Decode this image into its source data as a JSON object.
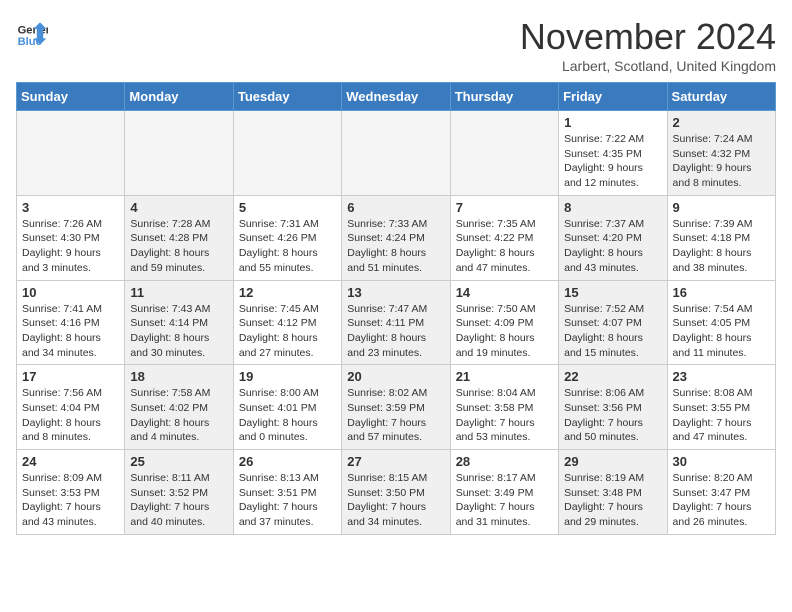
{
  "header": {
    "logo_line1": "General",
    "logo_line2": "Blue",
    "month_title": "November 2024",
    "location": "Larbert, Scotland, United Kingdom"
  },
  "days_of_week": [
    "Sunday",
    "Monday",
    "Tuesday",
    "Wednesday",
    "Thursday",
    "Friday",
    "Saturday"
  ],
  "weeks": [
    [
      {
        "day": "",
        "info": "",
        "empty": true
      },
      {
        "day": "",
        "info": "",
        "empty": true
      },
      {
        "day": "",
        "info": "",
        "empty": true
      },
      {
        "day": "",
        "info": "",
        "empty": true
      },
      {
        "day": "",
        "info": "",
        "empty": true
      },
      {
        "day": "1",
        "info": "Sunrise: 7:22 AM\nSunset: 4:35 PM\nDaylight: 9 hours and 12 minutes.",
        "empty": false,
        "shaded": false
      },
      {
        "day": "2",
        "info": "Sunrise: 7:24 AM\nSunset: 4:32 PM\nDaylight: 9 hours and 8 minutes.",
        "empty": false,
        "shaded": true
      }
    ],
    [
      {
        "day": "3",
        "info": "Sunrise: 7:26 AM\nSunset: 4:30 PM\nDaylight: 9 hours and 3 minutes.",
        "empty": false,
        "shaded": false
      },
      {
        "day": "4",
        "info": "Sunrise: 7:28 AM\nSunset: 4:28 PM\nDaylight: 8 hours and 59 minutes.",
        "empty": false,
        "shaded": true
      },
      {
        "day": "5",
        "info": "Sunrise: 7:31 AM\nSunset: 4:26 PM\nDaylight: 8 hours and 55 minutes.",
        "empty": false,
        "shaded": false
      },
      {
        "day": "6",
        "info": "Sunrise: 7:33 AM\nSunset: 4:24 PM\nDaylight: 8 hours and 51 minutes.",
        "empty": false,
        "shaded": true
      },
      {
        "day": "7",
        "info": "Sunrise: 7:35 AM\nSunset: 4:22 PM\nDaylight: 8 hours and 47 minutes.",
        "empty": false,
        "shaded": false
      },
      {
        "day": "8",
        "info": "Sunrise: 7:37 AM\nSunset: 4:20 PM\nDaylight: 8 hours and 43 minutes.",
        "empty": false,
        "shaded": true
      },
      {
        "day": "9",
        "info": "Sunrise: 7:39 AM\nSunset: 4:18 PM\nDaylight: 8 hours and 38 minutes.",
        "empty": false,
        "shaded": false
      }
    ],
    [
      {
        "day": "10",
        "info": "Sunrise: 7:41 AM\nSunset: 4:16 PM\nDaylight: 8 hours and 34 minutes.",
        "empty": false,
        "shaded": false
      },
      {
        "day": "11",
        "info": "Sunrise: 7:43 AM\nSunset: 4:14 PM\nDaylight: 8 hours and 30 minutes.",
        "empty": false,
        "shaded": true
      },
      {
        "day": "12",
        "info": "Sunrise: 7:45 AM\nSunset: 4:12 PM\nDaylight: 8 hours and 27 minutes.",
        "empty": false,
        "shaded": false
      },
      {
        "day": "13",
        "info": "Sunrise: 7:47 AM\nSunset: 4:11 PM\nDaylight: 8 hours and 23 minutes.",
        "empty": false,
        "shaded": true
      },
      {
        "day": "14",
        "info": "Sunrise: 7:50 AM\nSunset: 4:09 PM\nDaylight: 8 hours and 19 minutes.",
        "empty": false,
        "shaded": false
      },
      {
        "day": "15",
        "info": "Sunrise: 7:52 AM\nSunset: 4:07 PM\nDaylight: 8 hours and 15 minutes.",
        "empty": false,
        "shaded": true
      },
      {
        "day": "16",
        "info": "Sunrise: 7:54 AM\nSunset: 4:05 PM\nDaylight: 8 hours and 11 minutes.",
        "empty": false,
        "shaded": false
      }
    ],
    [
      {
        "day": "17",
        "info": "Sunrise: 7:56 AM\nSunset: 4:04 PM\nDaylight: 8 hours and 8 minutes.",
        "empty": false,
        "shaded": false
      },
      {
        "day": "18",
        "info": "Sunrise: 7:58 AM\nSunset: 4:02 PM\nDaylight: 8 hours and 4 minutes.",
        "empty": false,
        "shaded": true
      },
      {
        "day": "19",
        "info": "Sunrise: 8:00 AM\nSunset: 4:01 PM\nDaylight: 8 hours and 0 minutes.",
        "empty": false,
        "shaded": false
      },
      {
        "day": "20",
        "info": "Sunrise: 8:02 AM\nSunset: 3:59 PM\nDaylight: 7 hours and 57 minutes.",
        "empty": false,
        "shaded": true
      },
      {
        "day": "21",
        "info": "Sunrise: 8:04 AM\nSunset: 3:58 PM\nDaylight: 7 hours and 53 minutes.",
        "empty": false,
        "shaded": false
      },
      {
        "day": "22",
        "info": "Sunrise: 8:06 AM\nSunset: 3:56 PM\nDaylight: 7 hours and 50 minutes.",
        "empty": false,
        "shaded": true
      },
      {
        "day": "23",
        "info": "Sunrise: 8:08 AM\nSunset: 3:55 PM\nDaylight: 7 hours and 47 minutes.",
        "empty": false,
        "shaded": false
      }
    ],
    [
      {
        "day": "24",
        "info": "Sunrise: 8:09 AM\nSunset: 3:53 PM\nDaylight: 7 hours and 43 minutes.",
        "empty": false,
        "shaded": false
      },
      {
        "day": "25",
        "info": "Sunrise: 8:11 AM\nSunset: 3:52 PM\nDaylight: 7 hours and 40 minutes.",
        "empty": false,
        "shaded": true
      },
      {
        "day": "26",
        "info": "Sunrise: 8:13 AM\nSunset: 3:51 PM\nDaylight: 7 hours and 37 minutes.",
        "empty": false,
        "shaded": false
      },
      {
        "day": "27",
        "info": "Sunrise: 8:15 AM\nSunset: 3:50 PM\nDaylight: 7 hours and 34 minutes.",
        "empty": false,
        "shaded": true
      },
      {
        "day": "28",
        "info": "Sunrise: 8:17 AM\nSunset: 3:49 PM\nDaylight: 7 hours and 31 minutes.",
        "empty": false,
        "shaded": false
      },
      {
        "day": "29",
        "info": "Sunrise: 8:19 AM\nSunset: 3:48 PM\nDaylight: 7 hours and 29 minutes.",
        "empty": false,
        "shaded": true
      },
      {
        "day": "30",
        "info": "Sunrise: 8:20 AM\nSunset: 3:47 PM\nDaylight: 7 hours and 26 minutes.",
        "empty": false,
        "shaded": false
      }
    ]
  ]
}
